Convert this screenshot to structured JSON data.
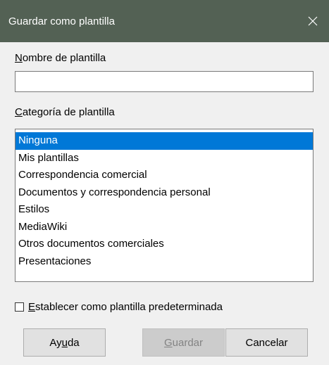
{
  "window": {
    "title": "Guardar como plantilla",
    "close_icon": "close-icon"
  },
  "name_section": {
    "label_mnemonic": "N",
    "label_rest": "ombre de plantilla",
    "value": "",
    "placeholder": ""
  },
  "category_section": {
    "label_mnemonic": "C",
    "label_rest": "ategoría de plantilla",
    "items": [
      {
        "label": "Ninguna",
        "selected": true
      },
      {
        "label": "Mis plantillas",
        "selected": false
      },
      {
        "label": "Correspondencia comercial",
        "selected": false
      },
      {
        "label": "Documentos y correspondencia personal",
        "selected": false
      },
      {
        "label": "Estilos",
        "selected": false
      },
      {
        "label": "MediaWiki",
        "selected": false
      },
      {
        "label": "Otros documentos comerciales",
        "selected": false
      },
      {
        "label": "Presentaciones",
        "selected": false
      }
    ]
  },
  "default_checkbox": {
    "label_mnemonic": "E",
    "label_rest": "stablecer como plantilla predeterminada",
    "checked": false
  },
  "buttons": {
    "help_prefix": "Ay",
    "help_mnemonic": "u",
    "help_suffix": "da",
    "save_mnemonic": "G",
    "save_rest": "uardar",
    "save_enabled": false,
    "cancel_label": "Cancelar"
  },
  "colors": {
    "titlebar": "#536154",
    "selection": "#0078d7"
  }
}
